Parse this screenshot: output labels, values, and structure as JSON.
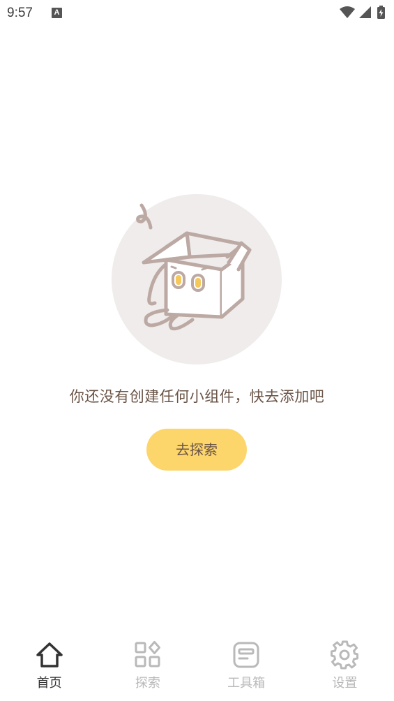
{
  "status_bar": {
    "time": "9:57",
    "notification_icon": "a-box-icon",
    "icons": [
      "wifi-icon",
      "signal-icon",
      "battery-charging-icon"
    ]
  },
  "empty_state": {
    "illustration": "open-box-character",
    "message": "你还没有创建任何小组件，快去添加吧",
    "button_label": "去探索"
  },
  "colors": {
    "accent": "#fcd56b",
    "text": "#6b5547",
    "illustration_circle": "#efeceb",
    "illustration_line": "#bca9a3",
    "nav_active": "#333333",
    "nav_inactive": "#b9b9b9"
  },
  "bottom_nav": {
    "items": [
      {
        "label": "首页",
        "icon": "home-icon",
        "active": true
      },
      {
        "label": "探索",
        "icon": "grid-icon",
        "active": false
      },
      {
        "label": "工具箱",
        "icon": "toolbox-icon",
        "active": false
      },
      {
        "label": "设置",
        "icon": "gear-icon",
        "active": false
      }
    ]
  }
}
